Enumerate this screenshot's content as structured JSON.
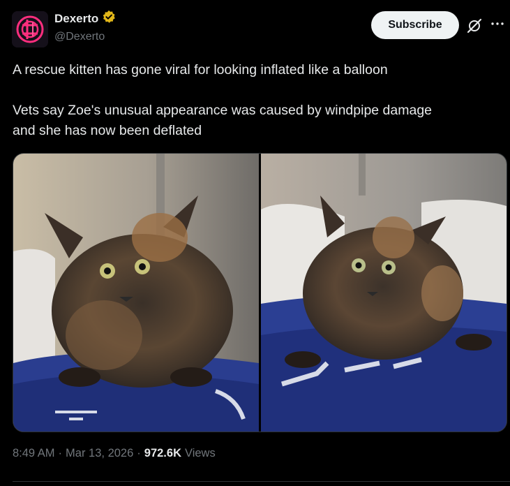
{
  "author": {
    "display_name": "Dexerto",
    "handle": "@Dexerto",
    "verified": true,
    "verified_color": "#e2b719",
    "brand_color": "#ff2e7e"
  },
  "actions": {
    "subscribe_label": "Subscribe",
    "grok_icon": "grok-icon",
    "more_icon": "more-icon"
  },
  "tweet": {
    "paragraph_1": "A rescue kitten has gone viral for looking inflated like a balloon",
    "paragraph_2_line_1": "Vets say Zoe's unusual appearance was caused by windpipe damage",
    "paragraph_2_line_2": "and she has now been deflated"
  },
  "media": {
    "image_count": 2,
    "left_alt": "kitten-photo-inflated",
    "right_alt": "kitten-photo-deflated"
  },
  "meta": {
    "time": "8:49 AM",
    "separator": "·",
    "date": "Mar 13, 2026",
    "views_count": "972.6K",
    "views_label": "Views"
  }
}
